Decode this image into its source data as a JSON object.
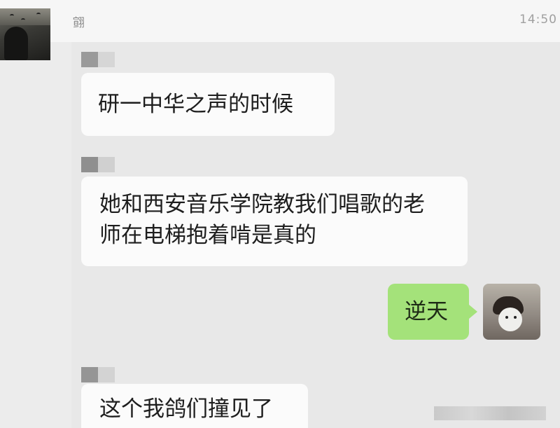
{
  "header": {
    "sender_name": "翧",
    "time": "14:50"
  },
  "messages": [
    {
      "direction": "received",
      "lines": [
        "研一中华之声的时候"
      ]
    },
    {
      "direction": "received",
      "lines": [
        "她和西安音乐学院教我们唱歌的老",
        "师在电梯抱着啃是真的"
      ]
    },
    {
      "direction": "sent",
      "lines": [
        "逆天"
      ]
    },
    {
      "direction": "received",
      "lines": [
        "这个我鸽们撞见了"
      ]
    }
  ],
  "icons": {
    "left_avatar": "profile-photo-icon",
    "right_avatar": "profile-photo-icon",
    "mosaic": "redacted-name-icon"
  },
  "colors": {
    "sent_bubble": "#a4e27a",
    "received_bubble": "#fbfbfb",
    "background": "#e8e8e8"
  }
}
